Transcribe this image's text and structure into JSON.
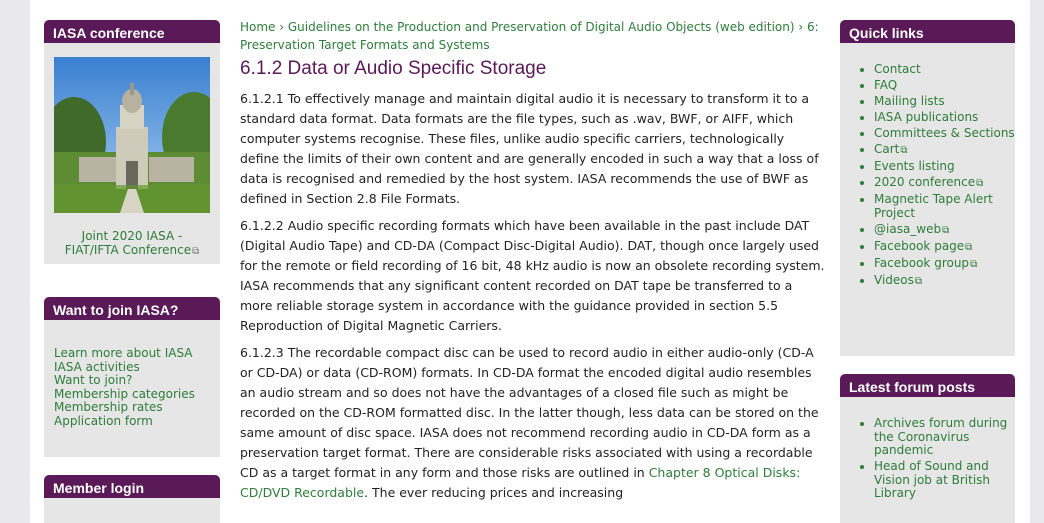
{
  "colors": {
    "accent": "#5a1a57",
    "link": "#2e7d3a",
    "sidebar_bg": "#e6e6e6"
  },
  "left": {
    "conference": {
      "title": "IASA conference",
      "photo_icon": "building-photo",
      "caption_line1": "Joint 2020 IASA -",
      "caption_line2": "FIAT/IFTA Conference"
    },
    "join": {
      "title": "Want to join IASA?",
      "links": [
        "Learn more about IASA",
        "IASA activities",
        "Want to join?",
        "Membership categories",
        "Membership rates",
        "Application form"
      ]
    },
    "login": {
      "title": "Member login"
    }
  },
  "main": {
    "breadcrumb_line1": "Home › Guidelines on the Production and Preservation of Digital Audio Objects (web edition) › 6:",
    "breadcrumb_line2": "Preservation Target Formats and Systems",
    "title": "6.1.2 Data or Audio Specific Storage",
    "p1": "6.1.2.1 To effectively manage and maintain digital audio it is necessary to transform it to a standard data format. Data formats are the file types, such as .wav, BWF, or AIFF, which computer systems recognise. These files, unlike audio specific carriers, technologically define the limits of their own content and are generally encoded in such a way that a loss of data is recognised and remedied by the host system. IASA recommends the use of BWF as defined in Section 2.8 File Formats.",
    "p2": "6.1.2.2 Audio specific recording formats which have been available in the past include DAT (Digital Audio Tape) and CD-DA (Compact Disc-Digital Audio). DAT, though once largely used for the remote or field recording of 16 bit, 48 kHz audio is now an obsolete recording system. IASA recommends that any significant content recorded on DAT tape be transferred to a more reliable storage system in accordance with the guidance provided in section 5.5 Reproduction of Digital Magnetic Carriers.",
    "p3": "6.1.2.3 The recordable compact disc can be used to record audio in either audio-only (CD-A or CD-DA) or data (CD-ROM) formats. In CD-DA format the encoded digital audio resembles an audio stream and so does not have the advantages of a closed file such as might be recorded on the CD-ROM formatted disc. In the latter though, less data can be stored on the same amount of disc space. IASA does not recommend recording audio in CD-DA form as a preservation target format. There are considerable risks associated with using a recordable CD as a target format in any form and those risks are outlined in",
    "p3_link": "Chapter 8 Optical Disks: CD/DVD Recordable",
    "p3_tail": ". The ever reducing prices and increasing"
  },
  "right": {
    "quick": {
      "title": "Quick links",
      "items": [
        {
          "label": "Contact",
          "external": false
        },
        {
          "label": "FAQ",
          "external": false
        },
        {
          "label": "Mailing lists",
          "external": false
        },
        {
          "label": "IASA publications",
          "external": false
        },
        {
          "label": "Committees & Sections",
          "external": false
        },
        {
          "label": "Cart",
          "external": true
        },
        {
          "label": "Events listing",
          "external": false
        },
        {
          "label": "2020 conference",
          "external": true
        },
        {
          "label": "Magnetic Tape Alert Project",
          "external": false
        },
        {
          "label": "@iasa_web",
          "external": true
        },
        {
          "label": "Facebook page",
          "external": true
        },
        {
          "label": "Facebook group",
          "external": true
        },
        {
          "label": "Videos",
          "external": true
        }
      ]
    },
    "forum": {
      "title": "Latest forum posts",
      "items": [
        "Archives forum during the Coronavirus pandemic",
        "Head of Sound and Vision job at British Library"
      ]
    }
  }
}
